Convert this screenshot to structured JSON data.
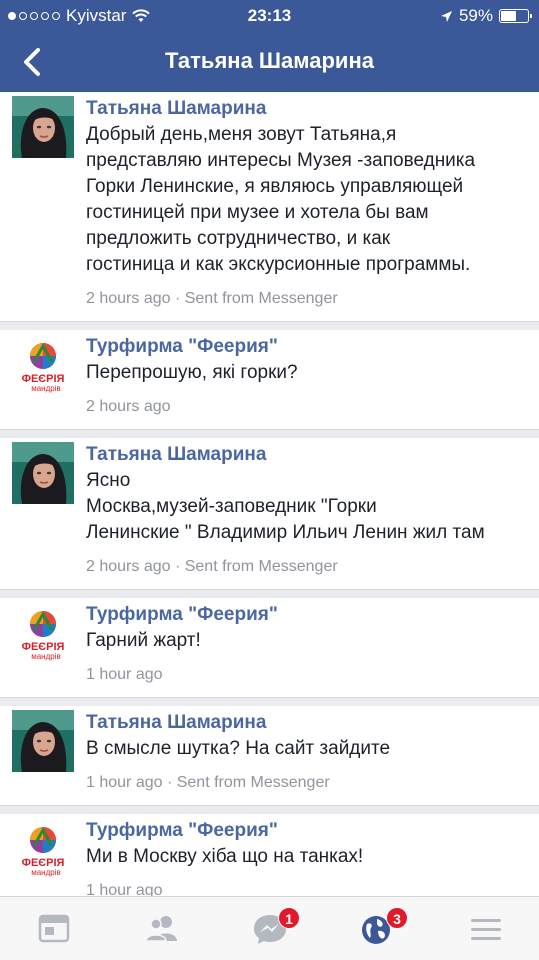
{
  "status_bar": {
    "carrier": "Kyivstar",
    "time": "23:13",
    "battery": "59%",
    "battery_level": 0.59
  },
  "header": {
    "title": "Татьяна Шамарина"
  },
  "messages": [
    {
      "author": "Татьяна Шамарина",
      "lines": [
        "Добрый день,меня зовут Татьяна,я",
        "представляю интересы Музея -заповедника",
        "Горки Ленинские, я являюсь управляющей",
        "гостиницей при музее и хотела бы вам",
        "предложить сотрудничество, и как",
        "гостиница и как экскурсионные программы."
      ],
      "meta": "2 hours ago · Sent from Messenger"
    },
    {
      "author": "Турфирма \"Феерия\"",
      "lines": [
        "Перепрошую, які горки?"
      ],
      "meta": "2 hours ago"
    },
    {
      "author": "Татьяна Шамарина",
      "lines": [
        "Ясно",
        "Москва,музей-заповедник \"Горки",
        "Ленинские \" Владимир Ильич Ленин жил там"
      ],
      "meta": "2 hours ago · Sent from Messenger"
    },
    {
      "author": "Турфирма \"Феерия\"",
      "lines": [
        "Гарний жарт!"
      ],
      "meta": "1 hour ago"
    },
    {
      "author": "Татьяна Шамарина",
      "lines": [
        "В смысле шутка? На сайт зайдите"
      ],
      "meta": "1 hour ago · Sent from Messenger"
    },
    {
      "author": "Турфирма \"Феерия\"",
      "lines": [
        "Ми в Москву хіба що на танках!"
      ],
      "meta": "1 hour ago"
    }
  ],
  "brand_logo": {
    "word": "ФЕЄРІЯ",
    "sub": "мандрів"
  },
  "tab_bar": {
    "tabs": [
      {
        "icon": "news-feed-icon",
        "badge": ""
      },
      {
        "icon": "friends-icon",
        "badge": ""
      },
      {
        "icon": "messenger-icon",
        "badge": "1"
      },
      {
        "icon": "globe-notifications-icon",
        "badge": "3"
      },
      {
        "icon": "menu-icon",
        "badge": ""
      }
    ]
  },
  "colors": {
    "brand_blue": "#3b5998",
    "author_blue": "#4b67a1",
    "badge_red": "#e0192b"
  }
}
